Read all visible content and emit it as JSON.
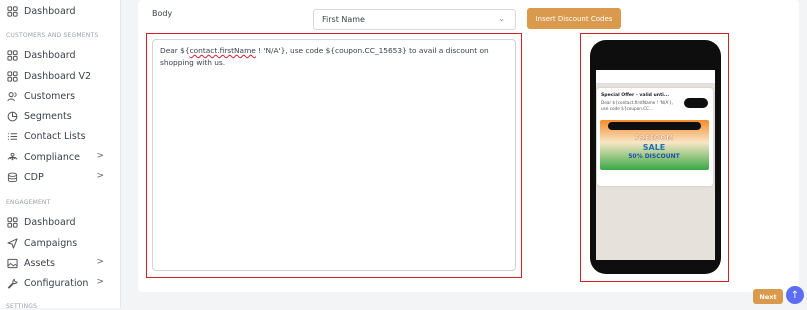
{
  "sidebar": {
    "top_item": {
      "label": "Dashboard",
      "icon": "grid-icon"
    },
    "sections": [
      {
        "title": "CUSTOMERS AND SEGMENTS"
      },
      {
        "title": "ENGAGEMENT"
      },
      {
        "title": "SETTINGS"
      }
    ],
    "items": [
      {
        "label": "Dashboard",
        "icon": "grid-icon"
      },
      {
        "label": "Dashboard V2",
        "icon": "grid-icon"
      },
      {
        "label": "Customers",
        "icon": "users-icon"
      },
      {
        "label": "Segments",
        "icon": "pie-icon"
      },
      {
        "label": "Contact Lists",
        "icon": "list-icon"
      },
      {
        "label": "Compliance",
        "icon": "compliance-icon",
        "chevron": ">"
      },
      {
        "label": "CDP",
        "icon": "database-icon",
        "chevron": ">"
      },
      {
        "label": "Dashboard",
        "icon": "grid-icon"
      },
      {
        "label": "Campaigns",
        "icon": "send-icon"
      },
      {
        "label": "Assets",
        "icon": "image-icon",
        "chevron": ">"
      },
      {
        "label": "Configuration",
        "icon": "wrench-icon",
        "chevron": ">"
      }
    ]
  },
  "main": {
    "body_label": "Body",
    "personalization_select": {
      "value": "First Name",
      "caret": "⌄"
    },
    "insert_button": "Insert Discount Codes",
    "editor": {
      "text_before": "Dear ${",
      "underlined": "contact.firstName",
      "text_after": " ! 'N/A'}, use code ${coupon.CC_15653} to avail a discount on shopping with us."
    },
    "preview": {
      "notification_title": "Special Offer - valid unti...",
      "notification_text": "Dear ${contact.firstName ! 'N/A'}, use code ${coupon.CC...",
      "banner_line1": "FREEDOM",
      "banner_line2": "SALE",
      "banner_line3": "50% DISCOUNT"
    },
    "next_button": "Next",
    "fab_icon": "↑"
  },
  "colors": {
    "accent": "#d99a4d",
    "highlight_border": "#d0212b",
    "fab": "#5b6ef5"
  }
}
